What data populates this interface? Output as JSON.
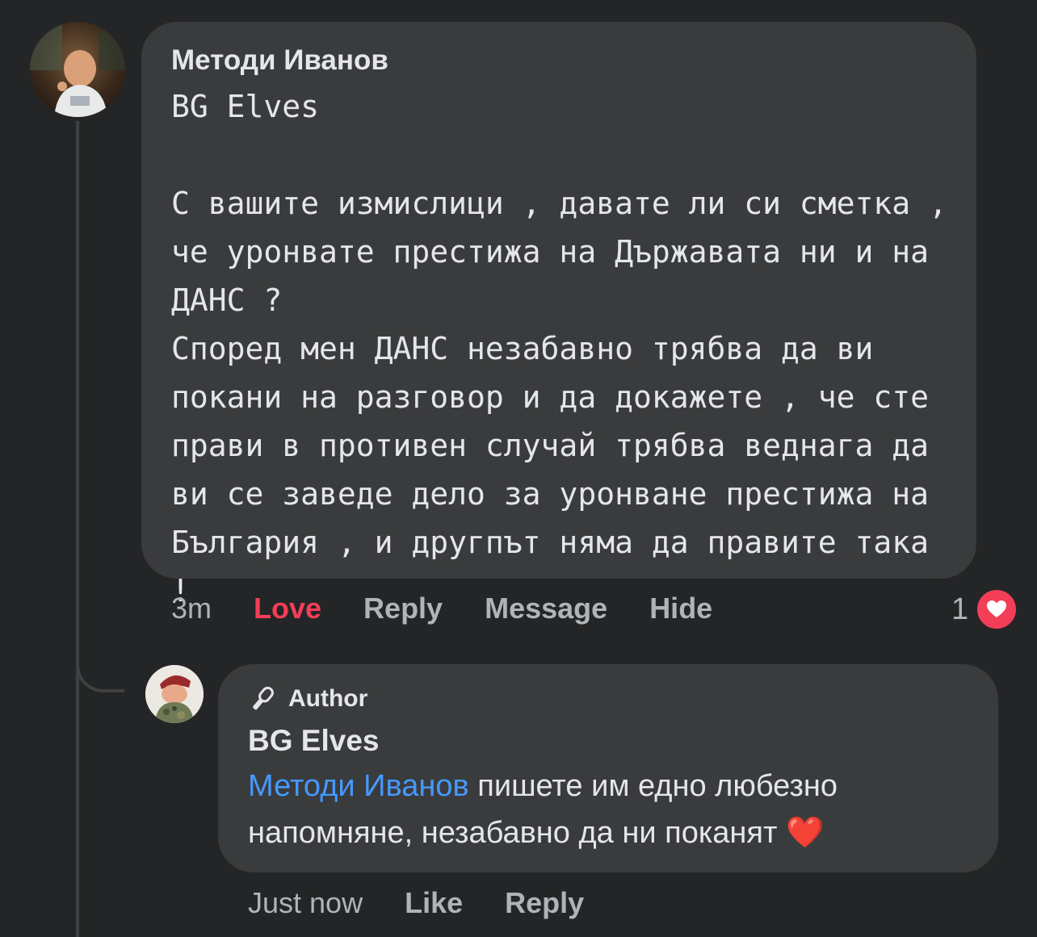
{
  "comment": {
    "author": "Методи Иванов",
    "text": "BG Elves\n\nС вашите измислици , давате ли си сметка ,\nче уронвате престижа на Държавата ни и на\nДАНС ?\nСпоред мен ДАНС незабавно трябва да ви\nпокани на разговор и да докажете , че сте\nправи в противен случай трябва веднага да\nви се заведе дело за уронване престижа на\nБългария , и другпът няма да правите така !",
    "time": "3m",
    "love_label": "Love",
    "reply_label": "Reply",
    "message_label": "Message",
    "hide_label": "Hide",
    "reaction_count": "1",
    "reaction_icon": "heart-icon",
    "love_color": "#f33e58"
  },
  "reply": {
    "badge_icon": "microphone-icon",
    "badge_label": "Author",
    "author": "BG Elves",
    "mention": "Методи Иванов",
    "text": " пишете им едно любезно напомняне, незабавно да ни поканят ",
    "emoji": "❤️",
    "time": "Just now",
    "like_label": "Like",
    "reply_label": "Reply",
    "mention_color": "#4599ff"
  }
}
